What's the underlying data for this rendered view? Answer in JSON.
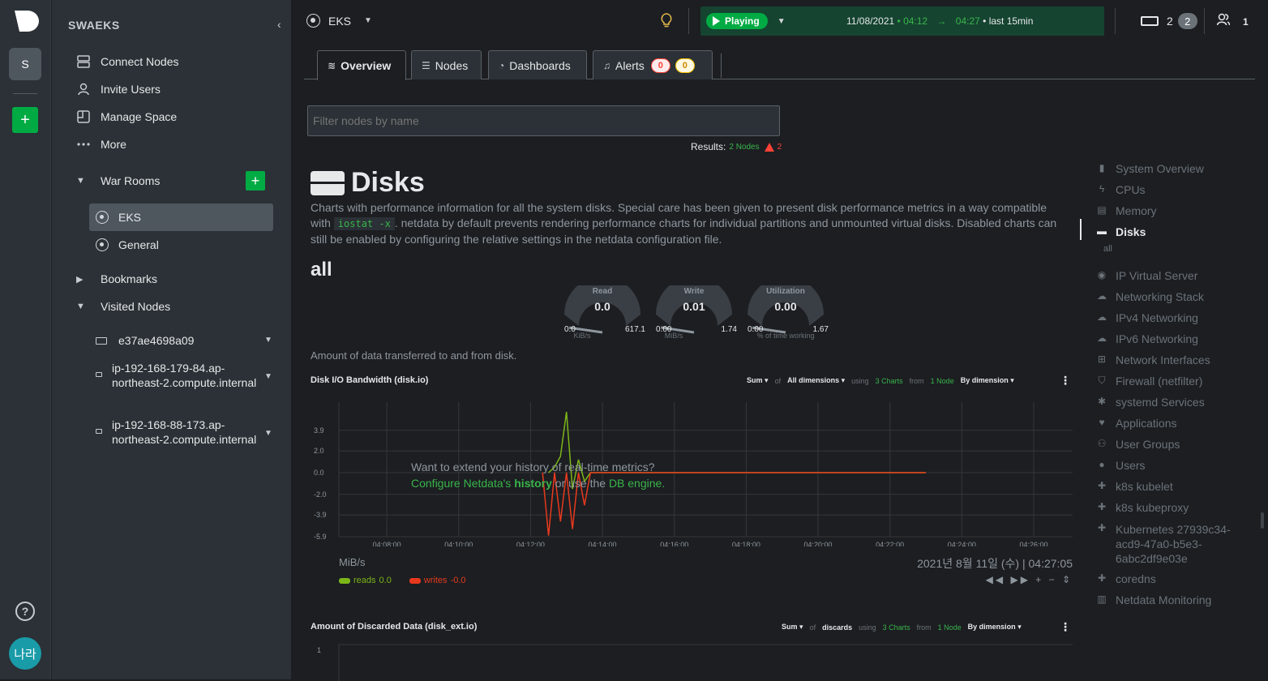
{
  "rail": {
    "space_initial": "S",
    "avatar_initials": "나라",
    "help": "?",
    "add": "+"
  },
  "sidebar": {
    "title": "SWAEKS",
    "collapse": "‹",
    "items": [
      {
        "label": "Connect Nodes",
        "icon": "server-icon"
      },
      {
        "label": "Invite Users",
        "icon": "user-icon"
      },
      {
        "label": "Manage Space",
        "icon": "manage-icon"
      },
      {
        "label": "More",
        "icon": "more-icon"
      }
    ],
    "war_rooms": {
      "label": "War Rooms",
      "rooms": [
        "EKS",
        "General"
      ],
      "active": "EKS"
    },
    "bookmarks": "Bookmarks",
    "visited": {
      "label": "Visited Nodes",
      "nodes": [
        "e37ae4698a09",
        "ip-192-168-179-84.ap-northeast-2.compute.internal",
        "ip-192-168-88-173.ap-northeast-2.compute.internal"
      ]
    }
  },
  "topbar": {
    "room": "EKS",
    "play_label": "Playing",
    "date": "11/08/2021",
    "from_time": "04:12",
    "to_time": "04:27",
    "range_label": "last 15min",
    "nodes_count": "2",
    "nodes_badge": "2",
    "users_count": "1"
  },
  "tabs": [
    {
      "label": "Overview",
      "active": true
    },
    {
      "label": "Nodes"
    },
    {
      "label": "Dashboards"
    },
    {
      "label": "Alerts",
      "critical": "0",
      "warning": "0"
    }
  ],
  "filter": {
    "placeholder": "Filter nodes by name"
  },
  "results": {
    "label": "Results:",
    "nodes": "2 Nodes",
    "alerts": "2"
  },
  "section": {
    "title": "Disks",
    "desc_pre": "Charts with performance information for all the system disks. Special care has been given to present disk performance metrics in a way compatible with",
    "code": "iostat -x",
    "desc_post": ". netdata by default prevents rendering performance charts for individual partitions and unmounted virtual disks. Disabled charts can still be enabled by configuring the relative settings in the netdata configuration file.",
    "subtitle": "all",
    "gauges": [
      {
        "title": "Read",
        "value": "0.0",
        "min": "0.0",
        "max": "617.1",
        "unit": "KiB/s",
        "fraction": 0.0
      },
      {
        "title": "Write",
        "value": "0.01",
        "min": "0.00",
        "max": "1.74",
        "unit": "MiB/s",
        "fraction": 0.006
      },
      {
        "title": "Utilization",
        "value": "0.00",
        "min": "0.00",
        "max": "1.67",
        "unit": "% of time working",
        "fraction": 0.0
      }
    ],
    "amount_text": "Amount of data transferred to and from disk."
  },
  "chart1": {
    "title": "Disk I/O Bandwidth (disk.io)",
    "agg": "Sum",
    "of": "of",
    "dims": "All dimensions",
    "using": "using",
    "charts": "3 Charts",
    "from": "from",
    "node": "1 Node",
    "group": "By dimension",
    "kebab": "⋮",
    "msg1": "Want to extend your history of real-time metrics?",
    "msg2a": "Configure Netdata's",
    "msg2b": "history",
    "msg2c": "or use the",
    "msg2d": "DB engine.",
    "unit": "MiB/s",
    "timestamp": "2021년 8월 11일 (수) | 04:27:05",
    "legend": [
      {
        "name": "reads",
        "value": "0.0",
        "color": "#7cb518"
      },
      {
        "name": "writes",
        "value": "-0.0",
        "color": "#e8391d"
      }
    ],
    "nav": "◀◀ ▶▶ + − ⇕"
  },
  "chart_data": {
    "type": "line",
    "ylim": [
      -5.9,
      5.9
    ],
    "yticks": [
      "3.9",
      "2.0",
      "0.0",
      "-2.0",
      "-3.9",
      "-5.9"
    ],
    "xticks": [
      "04:08:00",
      "04:10:00",
      "04:12:00",
      "04:14:00",
      "04:16:00",
      "04:18:00",
      "04:20:00",
      "04:22:00",
      "04:24:00",
      "04:26:00"
    ],
    "series": [
      {
        "name": "reads",
        "color": "#7cb518",
        "x": [
          "04:12:30",
          "04:12:40",
          "04:12:50",
          "04:13:00",
          "04:13:10",
          "04:13:20",
          "04:13:30",
          "04:13:40",
          "04:14:00",
          "04:23:00"
        ],
        "y": [
          0,
          0.5,
          1.5,
          5.6,
          -1.5,
          1.2,
          -0.8,
          0,
          0,
          0
        ]
      },
      {
        "name": "writes",
        "color": "#e8391d",
        "x": [
          "04:12:20",
          "04:12:30",
          "04:12:40",
          "04:12:50",
          "04:13:00",
          "04:13:10",
          "04:13:20",
          "04:13:30",
          "04:13:40",
          "04:14:00",
          "04:23:00"
        ],
        "y": [
          0,
          -5.8,
          0,
          -4.5,
          0,
          -5.2,
          0,
          -3.0,
          0,
          0,
          0
        ]
      }
    ]
  },
  "chart2": {
    "title": "Amount of Discarded Data (disk_ext.io)",
    "agg": "Sum",
    "of": "of",
    "dims": "discards",
    "using": "using",
    "charts": "3 Charts",
    "from": "from",
    "node": "1 Node",
    "group": "By dimension",
    "kebab": "⋮",
    "ytick": "1"
  },
  "toc": [
    {
      "label": "System Overview",
      "icon": "bookmark-icon"
    },
    {
      "label": "CPUs",
      "icon": "bolt-icon"
    },
    {
      "label": "Memory",
      "icon": "memory-icon"
    },
    {
      "label": "Disks",
      "icon": "disk-icon",
      "active": true
    },
    {
      "label": "IP Virtual Server",
      "icon": "eye-icon"
    },
    {
      "label": "Networking Stack",
      "icon": "cloud-icon"
    },
    {
      "label": "IPv4 Networking",
      "icon": "cloud-icon"
    },
    {
      "label": "IPv6 Networking",
      "icon": "cloud-icon"
    },
    {
      "label": "Network Interfaces",
      "icon": "sitemap-icon"
    },
    {
      "label": "Firewall (netfilter)",
      "icon": "shield-icon"
    },
    {
      "label": "systemd Services",
      "icon": "cogs-icon"
    },
    {
      "label": "Applications",
      "icon": "heartbeat-icon"
    },
    {
      "label": "User Groups",
      "icon": "users-icon"
    },
    {
      "label": "Users",
      "icon": "user-icon"
    },
    {
      "label": "k8s kubelet",
      "icon": "puzzle-icon"
    },
    {
      "label": "k8s kubeproxy",
      "icon": "puzzle-icon"
    },
    {
      "label": "Kubernetes 27939c34-acd9-47a0-b5e3-6abc2df9e03e",
      "icon": "puzzle-icon"
    },
    {
      "label": "coredns",
      "icon": "puzzle-icon"
    },
    {
      "label": "Netdata Monitoring",
      "icon": "chart-icon"
    }
  ],
  "toc_sub": "all"
}
